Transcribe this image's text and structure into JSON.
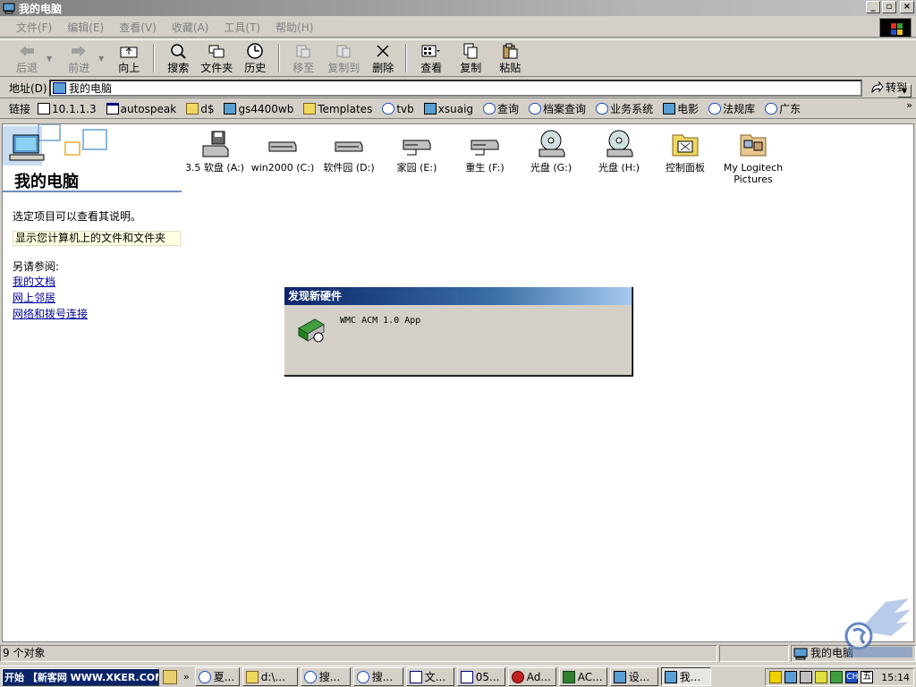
{
  "window": {
    "title": "我的电脑",
    "buttons": {
      "minimize": "_",
      "maximize": "▫",
      "close": "×"
    }
  },
  "menu": [
    "文件(F)",
    "编辑(E)",
    "查看(V)",
    "收藏(A)",
    "工具(T)",
    "帮助(H)"
  ],
  "toolbar": {
    "back": "后退",
    "forward": "前进",
    "up": "向上",
    "search": "搜索",
    "folders": "文件夹",
    "history": "历史",
    "move_to": "移至",
    "copy_to": "复制到",
    "delete": "删除",
    "view": "查看",
    "copy": "复制",
    "paste": "粘贴"
  },
  "address": {
    "label": "地址(D)",
    "value": "我的电脑",
    "go": "转到"
  },
  "links": {
    "label": "链接",
    "items": [
      "10.1.1.3",
      "autospeak",
      "d$",
      "gs4400wb",
      "Templates",
      "tvb",
      "xsuaig",
      "查询",
      "档案查询",
      "业务系统",
      "电影",
      "法规库",
      "广东"
    ],
    "more": "»"
  },
  "left_pane": {
    "title": "我的电脑",
    "instruction": "选定项目可以查看其说明。",
    "description": "显示您计算机上的文件和文件夹",
    "see_also": "另请参阅:",
    "links": [
      "我的文档",
      "网上邻居",
      "网络和拨号连接"
    ]
  },
  "drives": [
    {
      "label": "3.5 软盘 (A:)",
      "icon": "floppy-drive-icon"
    },
    {
      "label": "win2000 (C:)",
      "icon": "hard-disk-icon"
    },
    {
      "label": "软件园 (D:)",
      "icon": "hard-disk-icon"
    },
    {
      "label": "家园 (E:)",
      "icon": "network-drive-icon"
    },
    {
      "label": "重生 (F:)",
      "icon": "network-drive-icon"
    },
    {
      "label": "光盘 (G:)",
      "icon": "cd-drive-icon"
    },
    {
      "label": "光盘 (H:)",
      "icon": "cd-drive-icon"
    },
    {
      "label": "控制面板",
      "icon": "control-panel-icon"
    },
    {
      "label": "My Logitech Pictures",
      "icon": "pictures-folder-icon"
    }
  ],
  "dialog": {
    "title": "发现新硬件",
    "message": "WMC ACM 1.0 App"
  },
  "status": {
    "count": "9 个对象",
    "location": "我的电脑"
  },
  "taskbar": {
    "start": "开始 【新客网 WWW.XKER.COM】",
    "quicklaunch_more": "»",
    "tasks": [
      "夏...",
      "d:\\...",
      "搜...",
      "搜...",
      "文...",
      "05...",
      "Ad...",
      "AC...",
      "设...",
      "我..."
    ],
    "clock": "15:14",
    "tray_ime": [
      "CH",
      "五"
    ]
  },
  "colors": {
    "face": "#d4d0c8",
    "title_active": "#0a246a",
    "title_inactive": "#808080",
    "link": "#00009c",
    "info_bg": "#ffffe1"
  }
}
